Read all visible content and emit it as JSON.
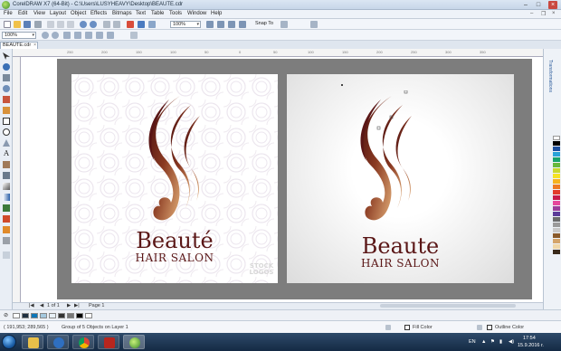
{
  "window": {
    "title": "CorelDRAW X7 (64-Bit) - C:\\Users\\LUSYHEAVY\\Desktop\\BEAUTE.cdr",
    "controls": [
      "–",
      "□",
      "×"
    ]
  },
  "menu": [
    "File",
    "Edit",
    "View",
    "Layout",
    "Object",
    "Effects",
    "Bitmaps",
    "Text",
    "Table",
    "Tools",
    "Window",
    "Help"
  ],
  "toolbar": {
    "zoom_value": "100%",
    "snap_label": "Snap To"
  },
  "property_bar": {
    "zoom_value": "100%"
  },
  "document_tab": {
    "label": "BEAUTE.cdr",
    "close": "×"
  },
  "ruler_ticks": [
    "250",
    "200",
    "150",
    "100",
    "50",
    "0",
    "50",
    "100",
    "150",
    "200",
    "250",
    "300",
    "350"
  ],
  "artwork": {
    "left": {
      "brand": "Beauté",
      "tagline": "HAIR SALON",
      "watermark_line1": "STOCK",
      "watermark_line2": "LOGOS"
    },
    "right": {
      "brand": "Beaute",
      "tagline": "HAIR SALON"
    }
  },
  "docker": {
    "tab_label": "Transformations"
  },
  "page_nav": {
    "first": "|◀",
    "prev": "◀",
    "counter": "1 of 1",
    "next": "▶",
    "last": "▶|",
    "page_label": "Page 1"
  },
  "status": {
    "coords": "( 191,953; 289,565 )",
    "object_info": "Group of 5 Objects on Layer 1",
    "fill_label": "Fill Color",
    "outline_label": "Outline Color"
  },
  "taskbar": {
    "language": "EN",
    "time": "17:54",
    "date": "15.9.2016 г."
  },
  "colors": {
    "accent": "#5a1616",
    "copper": "#c98a52",
    "dark_brown": "#4a0f10"
  }
}
